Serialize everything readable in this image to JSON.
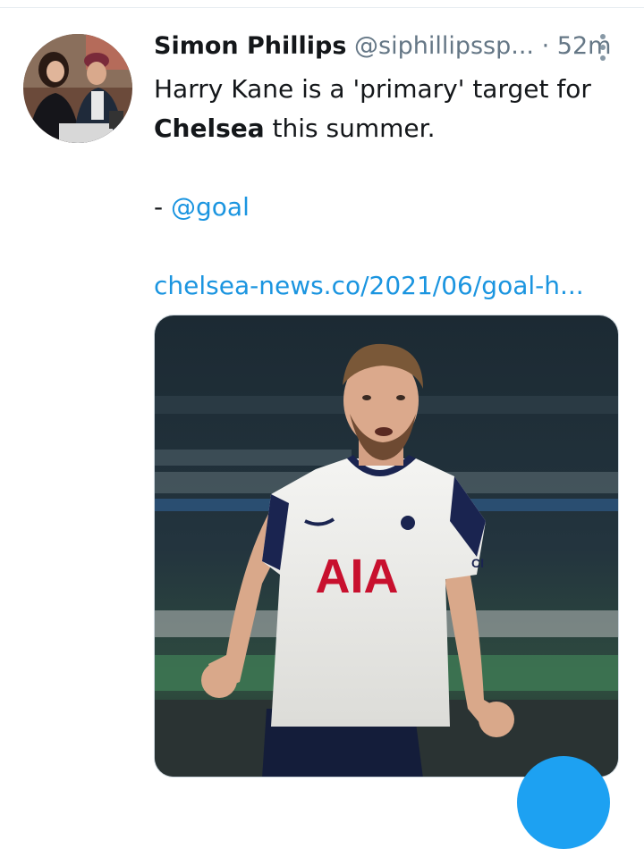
{
  "tweet": {
    "author_name": "Simon Phillips",
    "author_handle": "@siphillipssp...",
    "separator": "·",
    "time": "52m",
    "text_line1": "Harry Kane is a 'primary' target for",
    "text_line2_bold": "Chelsea",
    "text_line2_rest": " this summer.",
    "attribution_prefix": "- ",
    "attribution_mention": "@goal",
    "link": "chelsea-news.co/2021/06/goal-h...",
    "media": {
      "shirt_sponsor": "AIA",
      "sleeve_text": "CI"
    }
  },
  "icons": {
    "more": "more-vertical-icon",
    "compose": "compose-fab-icon"
  },
  "colors": {
    "link": "#1b95e0",
    "secondary_text": "#657786",
    "primary_text": "#14171a",
    "fab": "#1da1f2",
    "sponsor_red": "#c8102e"
  }
}
